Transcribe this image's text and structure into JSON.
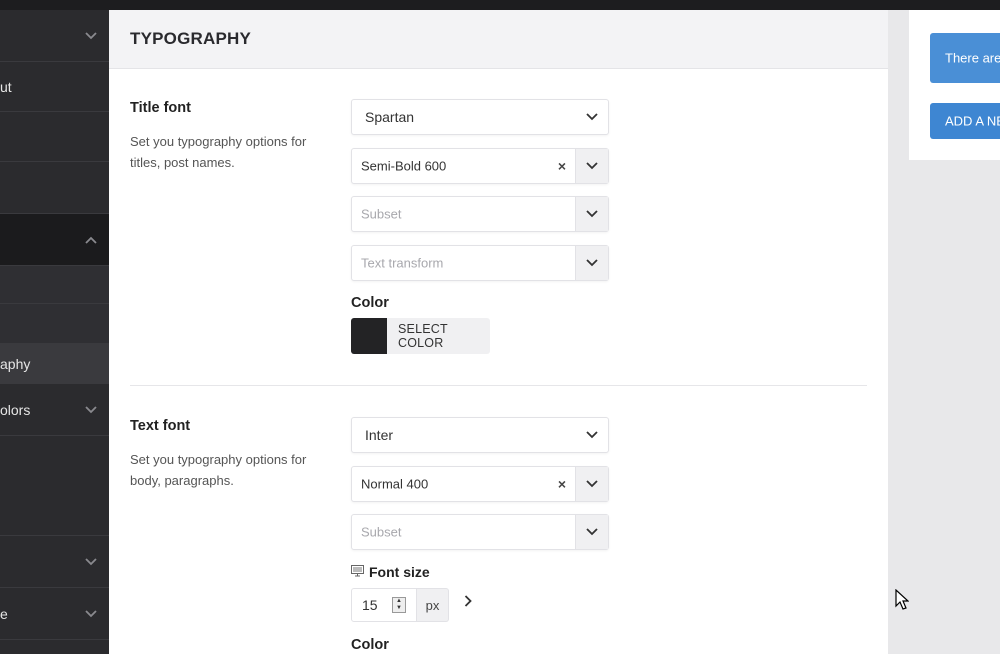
{
  "sidebar": {
    "items": [
      {
        "label": "",
        "chevron": "chevron-down-icon"
      },
      {
        "label": "ut"
      },
      {
        "label": ""
      },
      {
        "label": ""
      },
      {
        "label": "",
        "chevron": "chevron-up-icon"
      },
      {
        "label": ""
      },
      {
        "label": ""
      },
      {
        "label": "aphy"
      },
      {
        "label": "olors",
        "chevron": "chevron-down-icon"
      },
      {
        "label": ""
      },
      {
        "label": "",
        "chevron": "chevron-down-icon"
      },
      {
        "label": "e",
        "chevron": "chevron-down-icon"
      },
      {
        "label": ""
      }
    ]
  },
  "header": {
    "title": "TYPOGRAPHY"
  },
  "title_font": {
    "label": "Title font",
    "description": "Set you typography options for titles, post names.",
    "family": "Spartan",
    "weight": "Semi-Bold 600",
    "subset_placeholder": "Subset",
    "transform_placeholder": "Text transform",
    "color_label": "Color",
    "color_button": "SELECT COLOR",
    "color_value": "#232325"
  },
  "text_font": {
    "label": "Text font",
    "description": "Set you typography options for body, paragraphs.",
    "family": "Inter",
    "weight": "Normal 400",
    "subset_placeholder": "Subset",
    "font_size_label": "Font size",
    "font_size_value": "15",
    "font_size_unit": "px",
    "color_label": "Color"
  },
  "notice": {
    "text": "There are",
    "add_button": "ADD A NE"
  },
  "icons": {
    "clear": "×",
    "monitor": "monitor-icon"
  },
  "colors": {
    "accent": "#4a8fd6",
    "sidebar_bg": "#2b2b2e"
  }
}
